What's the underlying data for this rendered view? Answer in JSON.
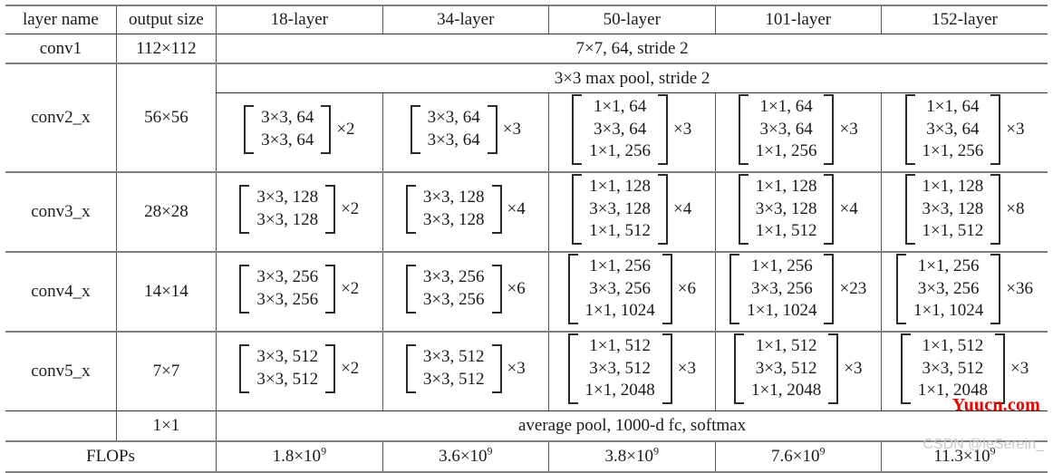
{
  "table": {
    "headers": {
      "layer_name": "layer name",
      "output_size": "output size",
      "columns": [
        "18-layer",
        "34-layer",
        "50-layer",
        "101-layer",
        "152-layer"
      ]
    },
    "rows": {
      "conv1": {
        "layer_name": "conv1",
        "output_size": "112×112",
        "spanning_text": "7×7, 64, stride 2"
      },
      "maxpool": {
        "spanning_text": "3×3 max pool, stride 2"
      },
      "conv2_x": {
        "layer_name": "conv2_x",
        "output_size": "56×56",
        "blocks": [
          {
            "lines": [
              "3×3, 64",
              "3×3, 64"
            ],
            "mult": "×2"
          },
          {
            "lines": [
              "3×3, 64",
              "3×3, 64"
            ],
            "mult": "×3"
          },
          {
            "lines": [
              "1×1, 64",
              "3×3, 64",
              "1×1, 256"
            ],
            "mult": "×3"
          },
          {
            "lines": [
              "1×1, 64",
              "3×3, 64",
              "1×1, 256"
            ],
            "mult": "×3"
          },
          {
            "lines": [
              "1×1, 64",
              "3×3, 64",
              "1×1, 256"
            ],
            "mult": "×3"
          }
        ]
      },
      "conv3_x": {
        "layer_name": "conv3_x",
        "output_size": "28×28",
        "blocks": [
          {
            "lines": [
              "3×3, 128",
              "3×3, 128"
            ],
            "mult": "×2"
          },
          {
            "lines": [
              "3×3, 128",
              "3×3, 128"
            ],
            "mult": "×4"
          },
          {
            "lines": [
              "1×1, 128",
              "3×3, 128",
              "1×1, 512"
            ],
            "mult": "×4"
          },
          {
            "lines": [
              "1×1, 128",
              "3×3, 128",
              "1×1, 512"
            ],
            "mult": "×4"
          },
          {
            "lines": [
              "1×1, 128",
              "3×3, 128",
              "1×1, 512"
            ],
            "mult": "×8"
          }
        ]
      },
      "conv4_x": {
        "layer_name": "conv4_x",
        "output_size": "14×14",
        "blocks": [
          {
            "lines": [
              "3×3, 256",
              "3×3, 256"
            ],
            "mult": "×2"
          },
          {
            "lines": [
              "3×3, 256",
              "3×3, 256"
            ],
            "mult": "×6"
          },
          {
            "lines": [
              "1×1, 256",
              "3×3, 256",
              "1×1, 1024"
            ],
            "mult": "×6"
          },
          {
            "lines": [
              "1×1, 256",
              "3×3, 256",
              "1×1, 1024"
            ],
            "mult": "×23"
          },
          {
            "lines": [
              "1×1, 256",
              "3×3, 256",
              "1×1, 1024"
            ],
            "mult": "×36"
          }
        ]
      },
      "conv5_x": {
        "layer_name": "conv5_x",
        "output_size": "7×7",
        "blocks": [
          {
            "lines": [
              "3×3, 512",
              "3×3, 512"
            ],
            "mult": "×2"
          },
          {
            "lines": [
              "3×3, 512",
              "3×3, 512"
            ],
            "mult": "×3"
          },
          {
            "lines": [
              "1×1, 512",
              "3×3, 512",
              "1×1, 2048"
            ],
            "mult": "×3"
          },
          {
            "lines": [
              "1×1, 512",
              "3×3, 512",
              "1×1, 2048"
            ],
            "mult": "×3"
          },
          {
            "lines": [
              "1×1, 512",
              "3×3, 512",
              "1×1, 2048"
            ],
            "mult": "×3"
          }
        ]
      },
      "avgpool": {
        "output_size": "1×1",
        "spanning_text": "average pool, 1000-d fc, softmax"
      },
      "flops": {
        "label": "FLOPs",
        "values": [
          {
            "mantissa": "1.8×10",
            "exponent": "9"
          },
          {
            "mantissa": "3.6×10",
            "exponent": "9"
          },
          {
            "mantissa": "3.8×10",
            "exponent": "9"
          },
          {
            "mantissa": "7.6×10",
            "exponent": "9"
          },
          {
            "mantissa": "11.3×10",
            "exponent": "9"
          }
        ]
      }
    }
  },
  "watermarks": {
    "primary": "Yuucn.com",
    "primary_color": "#ee0000",
    "secondary": "CSDN @leSerein_",
    "secondary_color": "#c9c9c9"
  }
}
